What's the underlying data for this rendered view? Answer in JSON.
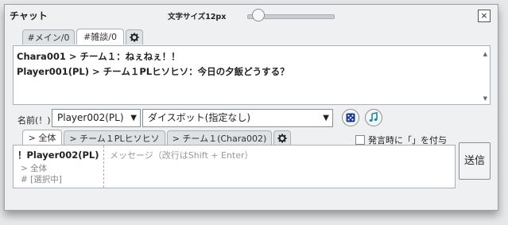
{
  "window": {
    "title": "チャット",
    "font_size_label": "文字サイズ12px",
    "font_size_slider_value": 0.12,
    "close_glyph": "×"
  },
  "log_tabs": [
    {
      "label": "#メイン/0",
      "active": false
    },
    {
      "label": "#雑談/0",
      "active": true
    }
  ],
  "log": {
    "lines": [
      "Chara001 > チーム１：ねぇねぇ！！",
      "Player001(PL) > チーム１PLヒソヒソ：今日の夕飯どうする？"
    ]
  },
  "name_row": {
    "label": "名前(！)",
    "name_value": "Player002(PL)",
    "dicebot_value": "ダイスボット(指定なし)",
    "dice_icon": "dice-icon",
    "music_icon": "music-note-icon"
  },
  "target_tabs": [
    {
      "label": "> 全体",
      "active": true
    },
    {
      "label": "> チーム１PLヒソヒソ",
      "active": false
    },
    {
      "label": "> チーム１(Chara002)",
      "active": false
    }
  ],
  "options": {
    "bracket_checkbox_label": "発言時に「」を付与",
    "bracket_checked": false
  },
  "input": {
    "sender": "！Player002(PL)",
    "target": "> 全体",
    "selection": "# [選択中]",
    "placeholder": "メッセージ（改行はShift + Enter）"
  },
  "send_button": "送信"
}
